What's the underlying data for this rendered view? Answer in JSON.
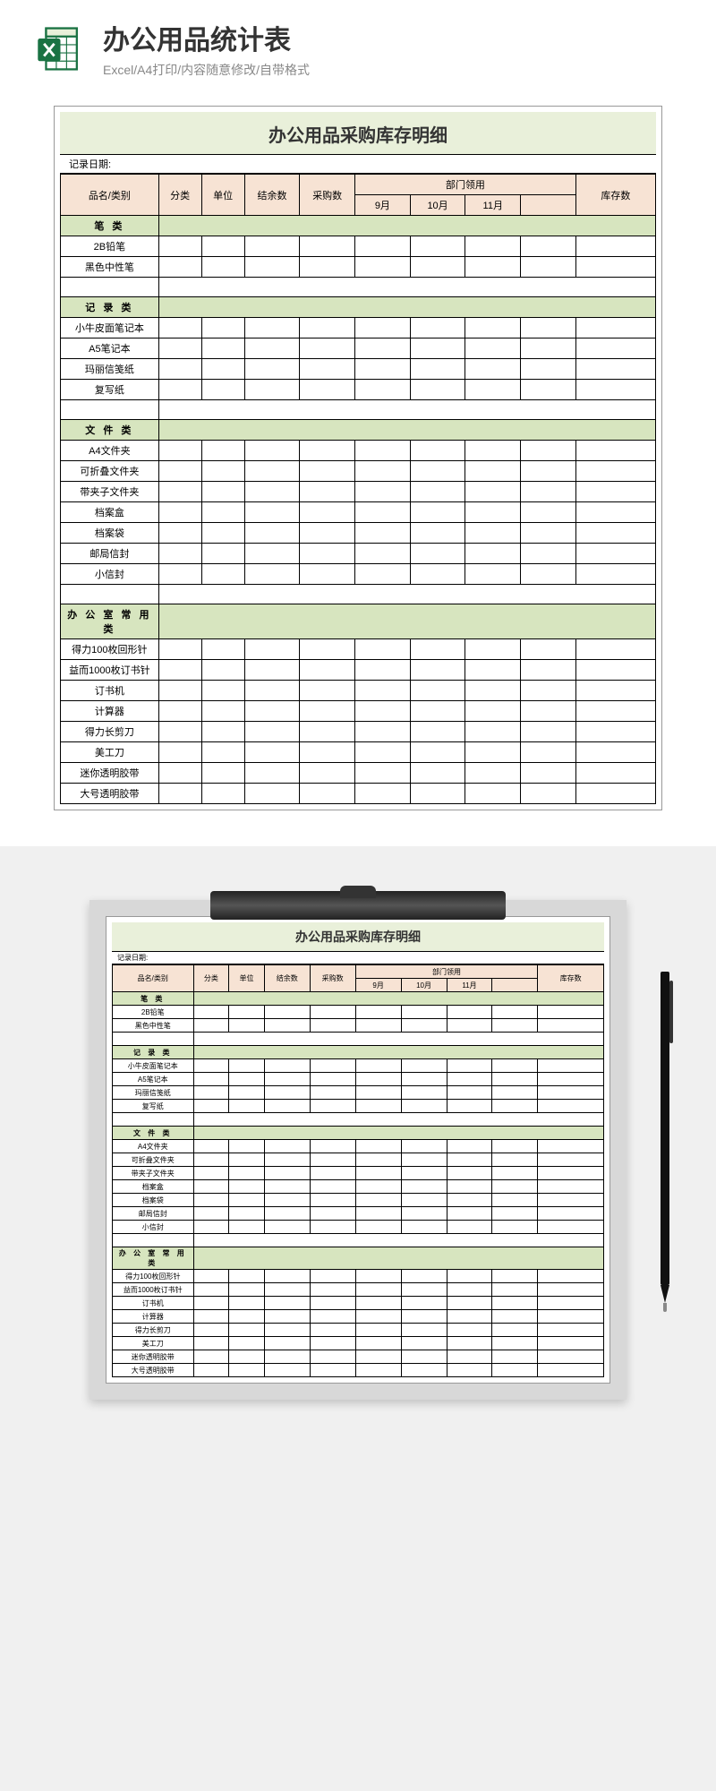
{
  "header": {
    "title": "办公用品统计表",
    "subtitle": "Excel/A4打印/内容随意修改/自带格式"
  },
  "sheet": {
    "title": "办公用品采购库存明细",
    "date_label": "记录日期:",
    "columns": {
      "name": "品名/类别",
      "category": "分类",
      "unit": "单位",
      "balance": "结余数",
      "purchase": "采购数",
      "dept_use": "部门领用",
      "month1": "9月",
      "month2": "10月",
      "month3": "11月",
      "stock": "库存数"
    }
  },
  "sections": [
    {
      "label": "笔 类",
      "items": [
        "2B铅笔",
        "黑色中性笔"
      ]
    },
    {
      "label": "记 录 类",
      "items": [
        "小牛皮面笔记本",
        "A5笔记本",
        "玛丽信笺纸",
        "复写纸"
      ]
    },
    {
      "label": "文 件 类",
      "items": [
        "A4文件夹",
        "可折叠文件夹",
        "带夹子文件夹",
        "档案盒",
        "档案袋",
        "邮局信封",
        "小信封"
      ]
    },
    {
      "label": "办 公 室 常 用 类",
      "items": [
        "得力100枚回形针",
        "益而1000枚订书针",
        "订书机",
        "计算器",
        "得力长剪刀",
        "美工刀",
        "迷你透明胶带",
        "大号透明胶带"
      ]
    }
  ]
}
